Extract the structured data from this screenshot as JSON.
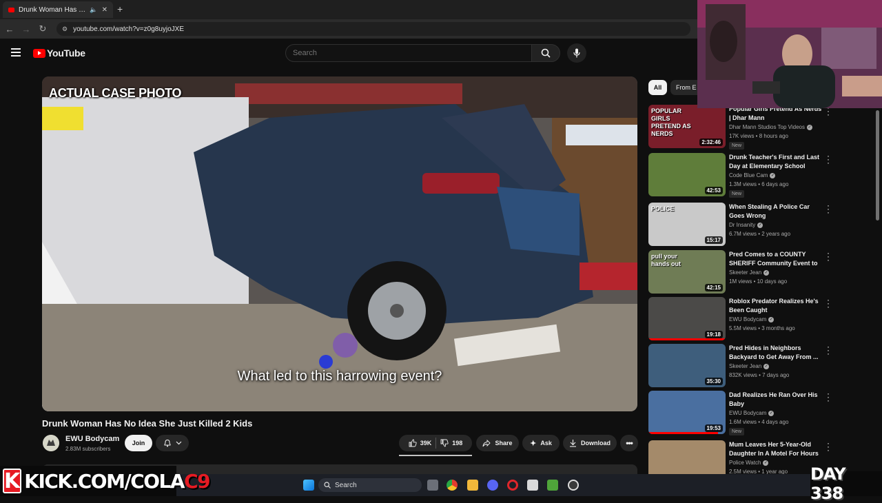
{
  "browser": {
    "tab_title": "Drunk Woman Has No Idea",
    "new_tab": "+",
    "url": "youtube.com/watch?v=z0g8uyjoJXE"
  },
  "header": {
    "logo_text": "YouTube",
    "search_placeholder": "Search"
  },
  "video": {
    "overlay_caption": "ACTUAL CASE PHOTO",
    "subtitle": "What led to this harrowing event?",
    "title": "Drunk Woman Has No Idea She Just Killed 2 Kids"
  },
  "channel": {
    "name": "EWU Bodycam",
    "subscribers": "2.83M subscribers",
    "join_label": "Join"
  },
  "actions": {
    "likes": "39K",
    "dislikes": "198",
    "share": "Share",
    "ask": "Ask",
    "download": "Download"
  },
  "chips": [
    "All",
    "From E"
  ],
  "recommendations": [
    {
      "title": "Popular Girls Pretend As Nerds | Dhar Mann",
      "channel": "Dhar Mann Studios Top Videos",
      "meta": "17K views • 8 hours ago",
      "duration": "2:32:46",
      "badge": "New",
      "thumb_text": "POPULAR GIRLS PRETEND AS NERDS",
      "thumb_color": "#7a1e2a",
      "progress": 0
    },
    {
      "title": "Drunk Teacher's First and Last Day at Elementary School",
      "channel": "Code Blue Cam",
      "meta": "1.3M views • 6 days ago",
      "duration": "42:53",
      "badge": "New",
      "thumb_text": "",
      "thumb_color": "#5f7d3a",
      "progress": 0
    },
    {
      "title": "When Stealing A Police Car Goes Wrong",
      "channel": "Dr Insanity",
      "meta": "6.7M views • 2 years ago",
      "duration": "15:17",
      "badge": "",
      "thumb_text": "POLICE",
      "thumb_color": "#c9c9c9",
      "progress": 0
    },
    {
      "title": "Pred Comes to a COUNTY SHERIFF Community Event to ...",
      "channel": "Skeeter Jean",
      "meta": "1M views • 10 days ago",
      "duration": "42:15",
      "badge": "",
      "thumb_text": "pull your hands out",
      "thumb_color": "#6f7c55",
      "progress": 0
    },
    {
      "title": "Roblox Predator Realizes He's Been Caught",
      "channel": "EWU Bodycam",
      "meta": "5.5M views • 3 months ago",
      "duration": "19:18",
      "badge": "",
      "thumb_text": "",
      "thumb_color": "#4b4a48",
      "progress": 1.0
    },
    {
      "title": "Pred Hides in Neighbors Backyard to Get Away From ...",
      "channel": "Skeeter Jean",
      "meta": "832K views • 7 days ago",
      "duration": "35:30",
      "badge": "",
      "thumb_text": "",
      "thumb_color": "#3e5e7c",
      "progress": 0
    },
    {
      "title": "Dad Realizes He Ran Over His Baby",
      "channel": "EWU Bodycam",
      "meta": "1.6M views • 4 days ago",
      "duration": "19:53",
      "badge": "New",
      "thumb_text": "",
      "thumb_color": "#4a6fa0",
      "progress": 0.9
    },
    {
      "title": "Mum Leaves Her 5-Year-Old Daughter In A Motel For Hours",
      "channel": "Police Watch",
      "meta": "2.5M views • 1 year ago",
      "duration": "",
      "badge": "",
      "thumb_text": "",
      "thumb_color": "#a48a6a",
      "progress": 0
    }
  ],
  "overlay": {
    "kick_k": "K",
    "kick_url_a": "KICK.COM/COLA",
    "kick_url_b": "C9",
    "day_label": "DAY 338"
  },
  "taskbar": {
    "search": "Search"
  },
  "colors": {
    "accent": "#ff0000",
    "kick_red": "#e61b23"
  }
}
